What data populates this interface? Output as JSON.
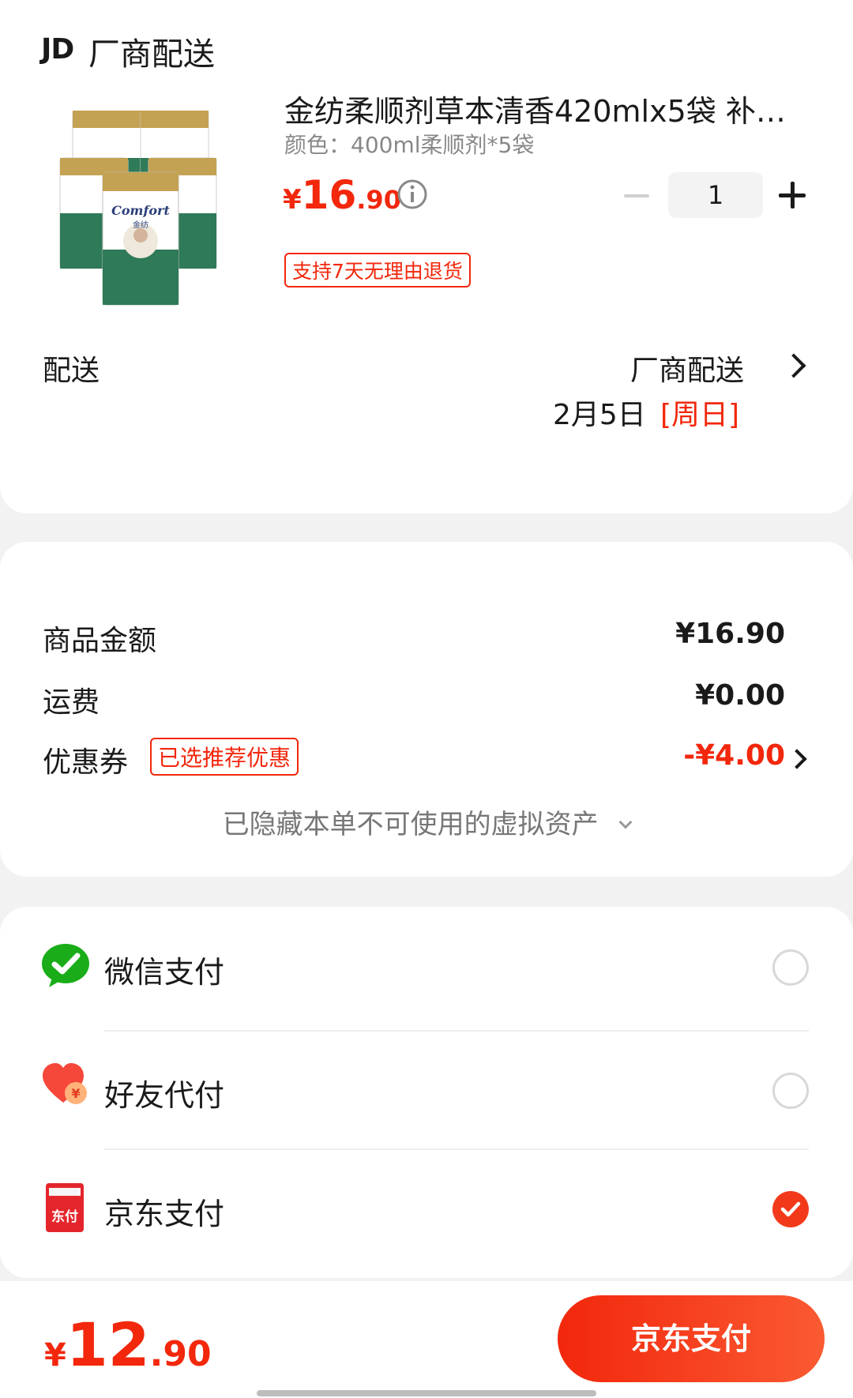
{
  "store": {
    "logo_text": "JD",
    "name": "厂商配送"
  },
  "product": {
    "title": "金纺柔顺剂草本清香420mlx5袋 补…",
    "variant": "颜色：400ml柔顺剂*5袋",
    "price_yen": "¥",
    "price_int": "16",
    "price_dec": ".90",
    "quantity": "1",
    "return_badge": "支持7天无理由退货",
    "image_brand": "Comfort",
    "image_brand_cn": "金纺"
  },
  "shipping": {
    "label": "配送",
    "value": "厂商配送",
    "date": "2月5日",
    "day": "[周日]"
  },
  "summary": {
    "goods_label": "商品金额",
    "goods_value": "¥16.90",
    "freight_label": "运费",
    "freight_value": "¥0.00",
    "coupon_label": "优惠券",
    "coupon_tag": "已选推荐优惠",
    "coupon_value": "-¥4.00",
    "hidden_assets": "已隐藏本单不可使用的虚拟资产"
  },
  "payment": {
    "methods": [
      {
        "label": "微信支付",
        "icon": "wechat-pay-icon",
        "selected": false
      },
      {
        "label": "好友代付",
        "icon": "friend-pay-icon",
        "selected": false
      },
      {
        "label": "京东支付",
        "icon": "jd-pay-icon",
        "selected": true
      }
    ],
    "jd_icon_text": "东付"
  },
  "bottom": {
    "total_yen": "¥",
    "total_int": "12",
    "total_dec": ".90",
    "pay_button": "京东支付"
  },
  "colors": {
    "accent": "#f2270c",
    "wechat": "#1aad19",
    "page_bg": "#f2f2f2"
  }
}
